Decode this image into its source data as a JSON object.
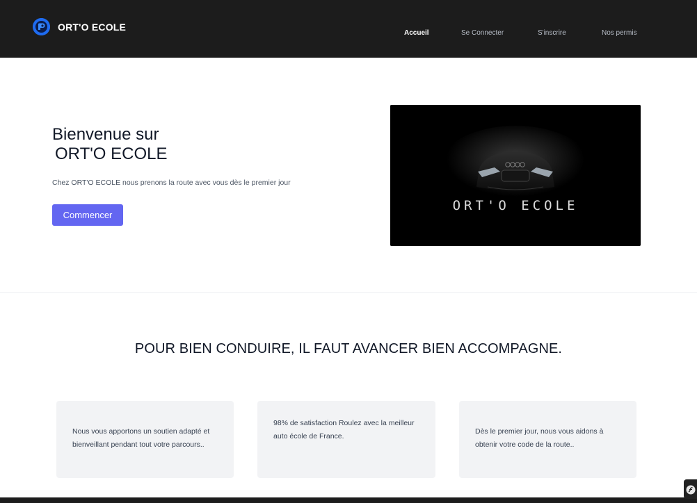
{
  "header": {
    "brand_name": "ORT'O ECOLE",
    "logo_icon": "brand-logo-icon",
    "nav": [
      {
        "label": "Accueil",
        "active": true
      },
      {
        "label": "Se Connecter",
        "active": false
      },
      {
        "label": "S'inscrire",
        "active": false
      },
      {
        "label": "Nos permis",
        "active": false
      }
    ]
  },
  "hero": {
    "title_line1": "Bienvenue sur",
    "title_line2": "ORT'O ECOLE",
    "subtitle": "Chez ORT'O ECOLE nous prenons la route avec vous dès le premier jour",
    "cta_label": "Commencer",
    "image": {
      "logo_text": "ORT'O ECOLE",
      "subject": "dark car front headlights"
    }
  },
  "section": {
    "title": "POUR BIEN CONDUIRE, IL FAUT AVANCER BIEN ACCOMPAGNE.",
    "cards": [
      {
        "text": "Nous vous apportons un soutien adapté et bienveillant pendant tout votre parcours.."
      },
      {
        "text": "98% de satisfaction Roulez avec la meilleur auto école de France."
      },
      {
        "text": "Dès le premier jour, nous vous aidons à obtenir votre code de la route.."
      }
    ]
  },
  "colors": {
    "header_bg": "#1c1c1c",
    "accent": "#6366f1",
    "logo_blue": "#1e6bf0",
    "card_bg": "#f2f3f5"
  },
  "debug_toolbar_icon": "symfony-icon"
}
